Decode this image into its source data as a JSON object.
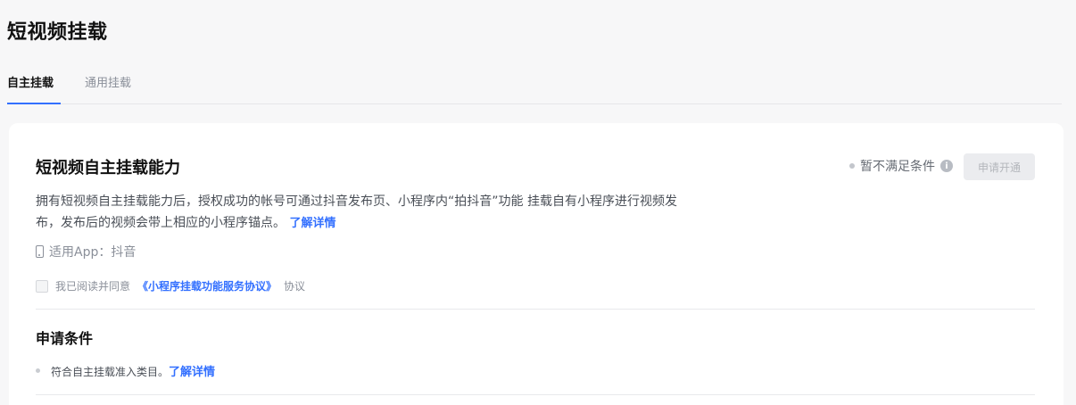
{
  "page": {
    "title": "短视频挂载"
  },
  "tabs": [
    {
      "label": "自主挂载"
    },
    {
      "label": "通用挂载"
    }
  ],
  "card": {
    "title": "短视频自主挂载能力",
    "status": "暂不满足条件",
    "apply_button": "申请开通",
    "description": "拥有短视频自主挂载能力后，授权成功的帐号可通过抖音发布页、小程序内“拍抖音”功能 挂载自有小程序进行视频发布，发布后的视频会带上相应的小程序锚点。",
    "learn_more": "了解详情",
    "app_label": "适用App：抖音",
    "agreement": {
      "prefix": "我已阅读并同意",
      "link": "《小程序挂载功能服务协议》",
      "suffix": "协议"
    },
    "conditions": {
      "title": "申请条件",
      "items": [
        {
          "text": "符合自主挂载准入类目。",
          "link": "了解详情"
        }
      ]
    }
  }
}
